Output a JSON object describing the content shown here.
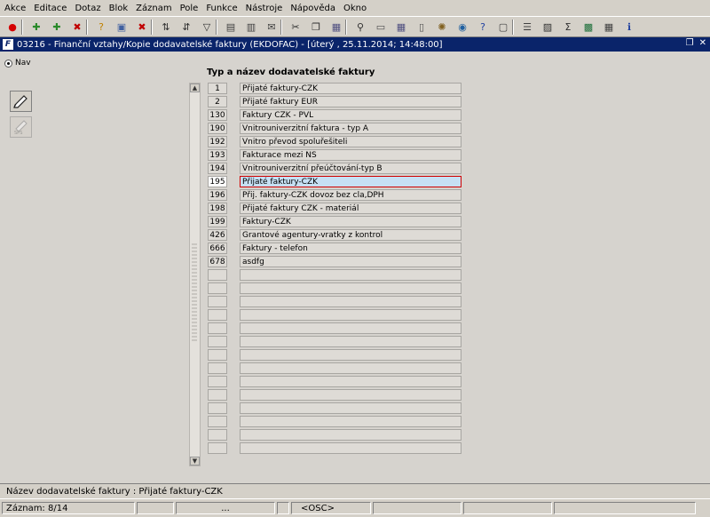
{
  "menu": [
    "Akce",
    "Editace",
    "Dotaz",
    "Blok",
    "Záznam",
    "Pole",
    "Funkce",
    "Nástroje",
    "Nápověda",
    "Okno"
  ],
  "toolbar_icons": [
    {
      "name": "exit-icon",
      "glyph": "●",
      "color": "#d40000"
    },
    {
      "name": "save-icon",
      "glyph": "✚",
      "color": "#2a8a2a"
    },
    {
      "name": "insert-record-icon",
      "glyph": "✚",
      "color": "#2a8a2a"
    },
    {
      "name": "delete-record-icon",
      "glyph": "✖",
      "color": "#c00000"
    },
    {
      "name": "enter-query-icon",
      "glyph": "?",
      "color": "#c08000"
    },
    {
      "name": "execute-query-icon",
      "glyph": "▣",
      "color": "#4060a0"
    },
    {
      "name": "cancel-query-icon",
      "glyph": "✖",
      "color": "#c00000"
    },
    {
      "name": "sort-icon",
      "glyph": "⇅",
      "color": "#303030"
    },
    {
      "name": "sort-desc-icon",
      "glyph": "⇵",
      "color": "#303030"
    },
    {
      "name": "filter-icon",
      "glyph": "▽",
      "color": "#303030"
    },
    {
      "name": "print-icon",
      "glyph": "▤",
      "color": "#404040"
    },
    {
      "name": "print-settings-icon",
      "glyph": "▥",
      "color": "#404040"
    },
    {
      "name": "mail-icon",
      "glyph": "✉",
      "color": "#404040"
    },
    {
      "name": "cut-icon",
      "glyph": "✂",
      "color": "#303030"
    },
    {
      "name": "copy-icon",
      "glyph": "❐",
      "color": "#303030"
    },
    {
      "name": "paste-icon",
      "glyph": "▦",
      "color": "#505080"
    },
    {
      "name": "find-icon",
      "glyph": "⚲",
      "color": "#303030"
    },
    {
      "name": "attach-icon",
      "glyph": "▭",
      "color": "#505050"
    },
    {
      "name": "calendar-icon",
      "glyph": "▦",
      "color": "#505080"
    },
    {
      "name": "document-icon",
      "glyph": "▯",
      "color": "#505050"
    },
    {
      "name": "settings-icon",
      "glyph": "✺",
      "color": "#806020"
    },
    {
      "name": "globe-icon",
      "glyph": "◉",
      "color": "#2060a0"
    },
    {
      "name": "help-icon",
      "glyph": "?",
      "color": "#2040a0"
    },
    {
      "name": "window-icon",
      "glyph": "▢",
      "color": "#404040"
    },
    {
      "name": "list-icon",
      "glyph": "☰",
      "color": "#404040"
    },
    {
      "name": "chart-icon",
      "glyph": "▨",
      "color": "#303030"
    },
    {
      "name": "sum-icon",
      "glyph": "Σ",
      "color": "#303030"
    },
    {
      "name": "excel-icon",
      "glyph": "▩",
      "color": "#1d6f3a"
    },
    {
      "name": "table-icon",
      "glyph": "▦",
      "color": "#404040"
    },
    {
      "name": "info-icon",
      "glyph": "ℹ",
      "color": "#2040a0"
    }
  ],
  "window": {
    "title": "03216 - Finanční vztahy/Kopie dodavatelské faktury (EKDOFAC) - [úterý  , 25.11.2014; 14:48:00]",
    "icon_letter": "F"
  },
  "nav": {
    "label": "Nav"
  },
  "block": {
    "heading": "Typ a název dodavatelské faktury",
    "rows": [
      {
        "code": "1",
        "name": "Přijaté faktury-CZK"
      },
      {
        "code": "2",
        "name": "Přijaté faktury EUR"
      },
      {
        "code": "130",
        "name": "Faktury CZK - PVL"
      },
      {
        "code": "190",
        "name": "Vnitrouniverzitní faktura - typ A"
      },
      {
        "code": "192",
        "name": "Vnitro převod spoluřešiteli"
      },
      {
        "code": "193",
        "name": "Fakturace mezi NS"
      },
      {
        "code": "194",
        "name": "Vnitrouniverzitní přeúčtování-typ B"
      },
      {
        "code": "195",
        "name": "Přijaté faktury-CZK"
      },
      {
        "code": "196",
        "name": "Přij. faktury-CZK dovoz bez cla,DPH"
      },
      {
        "code": "198",
        "name": "Přijaté faktury CZK - materiál"
      },
      {
        "code": "199",
        "name": "Faktury-CZK"
      },
      {
        "code": "426",
        "name": "Grantové agentury-vratky z kontrol"
      },
      {
        "code": "666",
        "name": "Faktury - telefon"
      },
      {
        "code": "678",
        "name": "asdfg"
      },
      {
        "code": "",
        "name": ""
      },
      {
        "code": "",
        "name": ""
      },
      {
        "code": "",
        "name": ""
      },
      {
        "code": "",
        "name": ""
      },
      {
        "code": "",
        "name": ""
      },
      {
        "code": "",
        "name": ""
      },
      {
        "code": "",
        "name": ""
      },
      {
        "code": "",
        "name": ""
      },
      {
        "code": "",
        "name": ""
      },
      {
        "code": "",
        "name": ""
      },
      {
        "code": "",
        "name": ""
      },
      {
        "code": "",
        "name": ""
      },
      {
        "code": "",
        "name": ""
      },
      {
        "code": "",
        "name": ""
      }
    ],
    "selected_index": 7
  },
  "hint": "Název dodavatelské faktury : Přijaté faktury-CZK",
  "status": {
    "record": "Záznam: 8/14",
    "ellipsis": "...",
    "mode": "<OSC>"
  },
  "colors": {
    "title_bar": "#0a246a",
    "selection_fill": "#c6e0f4",
    "selection_border": "#d00000"
  }
}
